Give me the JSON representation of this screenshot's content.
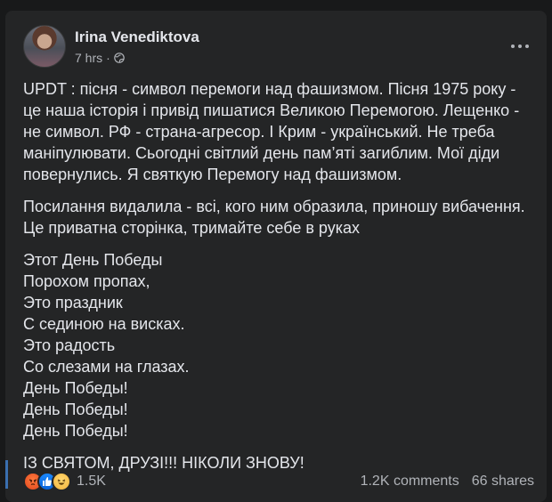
{
  "post": {
    "author": "Irina Venediktova",
    "time": "7 hrs",
    "separator": "·",
    "audience_icon": "globe-icon",
    "paragraphs": [
      "UPDT : пісня - символ перемоги над фашизмом. Пісня 1975 року - це наша історія і привід пишатися Великою Перемогою. Лещенко - не символ. РФ - страна-агресор. І Крим - український. Не треба маніпулювати. Сьогодні світлий день пам’яті загиблим. Мої діди повернулись. Я святкую Перемогу над фашизмом.",
      "Посилання видалила - всі, кого ним образила, приношу вибачення. Це приватна сторінка, тримайте себе в руках"
    ],
    "lines_p1": [
      "UPDT : пісня - символ перемоги над фашизмом. Пісня 1975 року -",
      "це наша історія і привід пишатися Великою Перемогою. Лещенко -",
      "не символ. РФ - страна-агресор. І Крим - український. Не треба",
      "маніпулювати. Сьогодні світлий день пам’яті загиблим. Мої діди",
      "повернулись. Я святкую Перемогу над фашизмом."
    ],
    "lines_p2": [
      "Посилання видалила - всі, кого ним образила, приношу вибачення.",
      "Це приватна сторінка, тримайте себе в руках"
    ],
    "poem": [
      "Этот День Победы",
      "Порохом пропах,",
      "Это праздник",
      "С сединою на висках.",
      "Это радость",
      "Со слезами на глазах.",
      "День Победы!",
      "День Победы!",
      "День Победы!"
    ],
    "closing": "ІЗ СВЯТОМ, ДРУЗІ!!! НІКОЛИ ЗНОВУ!"
  },
  "footer": {
    "reactions": [
      "angry",
      "like",
      "haha"
    ],
    "reaction_count": "1.5K",
    "comments": "1.2K comments",
    "shares": "66 shares"
  },
  "colors": {
    "background": "#18191a",
    "card": "#242526",
    "text": "#e4e6eb",
    "secondary": "#b0b3b8"
  }
}
